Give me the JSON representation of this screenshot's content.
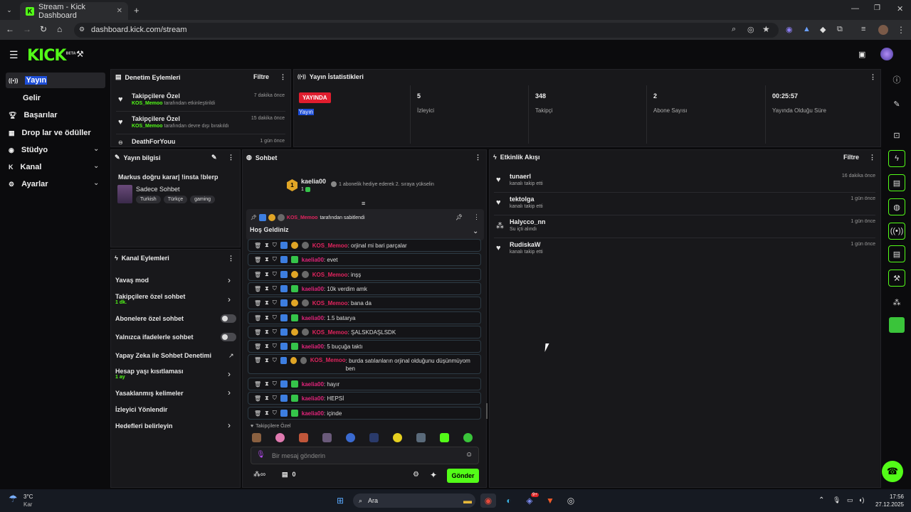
{
  "browser": {
    "tab_title": "Stream - Kick Dashboard",
    "url": "dashboard.kick.com/stream"
  },
  "app": {
    "logo": "KICK",
    "beta": "BETA"
  },
  "sidebar": {
    "items": [
      {
        "label": "Yayın"
      },
      {
        "label": "Gelir"
      },
      {
        "label": "Başarılar"
      },
      {
        "label": "Drop lar ve ödüller"
      },
      {
        "label": "Stüdyo"
      },
      {
        "label": "Kanal"
      },
      {
        "label": "Ayarlar"
      }
    ]
  },
  "moderation": {
    "title": "Denetim Eylemleri",
    "filter": "Filtre",
    "entries": [
      {
        "title": "Takipçilere Özel",
        "user": "KOS_Memoo",
        "action": "tarafından etkinleştirildi",
        "time": "7 dakika önce"
      },
      {
        "title": "Takipçilere Özel",
        "user": "KOS_Memoo",
        "action": "tarafından devre dışı bırakıldı",
        "time": "15 dakika önce"
      },
      {
        "title": "DeathForYouu",
        "user": "",
        "action": "",
        "time": "1 gün önce"
      }
    ]
  },
  "stats": {
    "title": "Yayın İstatistikleri",
    "live_badge": "YAYINDA",
    "live_sub": "Yayın",
    "items": [
      {
        "value": "5",
        "label": "İzleyici"
      },
      {
        "value": "348",
        "label": "Takipçi"
      },
      {
        "value": "2",
        "label": "Abone Sayısı"
      },
      {
        "value": "00:25:57",
        "label": "Yayında Olduğu Süre"
      }
    ]
  },
  "stream_info": {
    "title": "Yayın bilgisi",
    "stream_title": "Markus doğru karar| !insta !blerp",
    "category": "Sadece Sohbet",
    "tags": [
      "Turkish",
      "Türkçe",
      "gaming"
    ]
  },
  "channel_actions": {
    "title": "Kanal Eylemleri",
    "items": [
      {
        "label": "Yavaş mod",
        "sub": ""
      },
      {
        "label": "Takipçilere özel sohbet",
        "sub": "1 dk."
      },
      {
        "label": "Abonelere özel sohbet",
        "sub": ""
      },
      {
        "label": "Yalnızca ifadelerle sohbet",
        "sub": ""
      },
      {
        "label": "Yapay Zeka ile Sohbet Denetimi",
        "sub": ""
      },
      {
        "label": "Hesap yaşı kısıtlaması",
        "sub": "1 ay"
      },
      {
        "label": "Yasaklanmış kelimeler",
        "sub": ""
      },
      {
        "label": "İzleyici Yönlendir",
        "sub": ""
      },
      {
        "label": "Hedefleri belirleyin",
        "sub": ""
      }
    ]
  },
  "chat": {
    "title": "Sohbet",
    "top_user": "kaelia00",
    "top_sub": "1",
    "gift_text": "1 abonelik hediye ederek 2. sıraya yükselin",
    "pinned": {
      "by_user": "KOS_Memoo",
      "by_text": "tarafından sabitlendi",
      "message": "Hoş Geldiniz"
    },
    "messages": [
      {
        "user": "KOS_Memoo",
        "text": ": orjinal mi bari parçalar",
        "mod": true
      },
      {
        "user": "kaelia00",
        "text": ": evet",
        "mod": false
      },
      {
        "user": "KOS_Memoo",
        "text": ": inşş",
        "mod": true
      },
      {
        "user": "kaelia00",
        "text": ": 10k verdim amk",
        "mod": false
      },
      {
        "user": "KOS_Memoo",
        "text": ": bana da",
        "mod": true
      },
      {
        "user": "kaelia00",
        "text": ": 1.5 batarya",
        "mod": false
      },
      {
        "user": "KOS_Memoo",
        "text": ": ŞALSKDAŞLSDK",
        "mod": true
      },
      {
        "user": "kaelia00",
        "text": ": 5 buçuğa taktı",
        "mod": false
      },
      {
        "user": "KOS_Memoo",
        "text": ": burda satılanların orjinal olduğunu düşünmüyom ben",
        "mod": true
      },
      {
        "user": "kaelia00",
        "text": ": hayır",
        "mod": false
      },
      {
        "user": "kaelia00",
        "text": ": HEPSİ",
        "mod": false
      },
      {
        "user": "kaelia00",
        "text": ": içinde",
        "mod": false
      }
    ],
    "followers_only": "Takipçilere Özel",
    "placeholder": "Bir mesaj gönderin",
    "points": "0",
    "send": "Gönder"
  },
  "activity": {
    "title": "Etkinlik Akışı",
    "filter": "Filtre",
    "events": [
      {
        "name": "tunaerl",
        "desc": "kanalı takip etti",
        "time": "16 dakika önce"
      },
      {
        "name": "tektolga",
        "desc": "kanalı takip etti",
        "time": "1 gün önce"
      },
      {
        "name": "Halycco_nn",
        "desc": "Su içti alındı",
        "time": "1 gün önce"
      },
      {
        "name": "RudiskaW",
        "desc": "kanalı takip etti",
        "time": "1 gün önce"
      }
    ]
  },
  "taskbar": {
    "weather_temp": "3°C",
    "weather_desc": "Kar",
    "search": "Ara",
    "time": "17:56",
    "date": "27.12.2025",
    "discord_badge": "9+"
  }
}
